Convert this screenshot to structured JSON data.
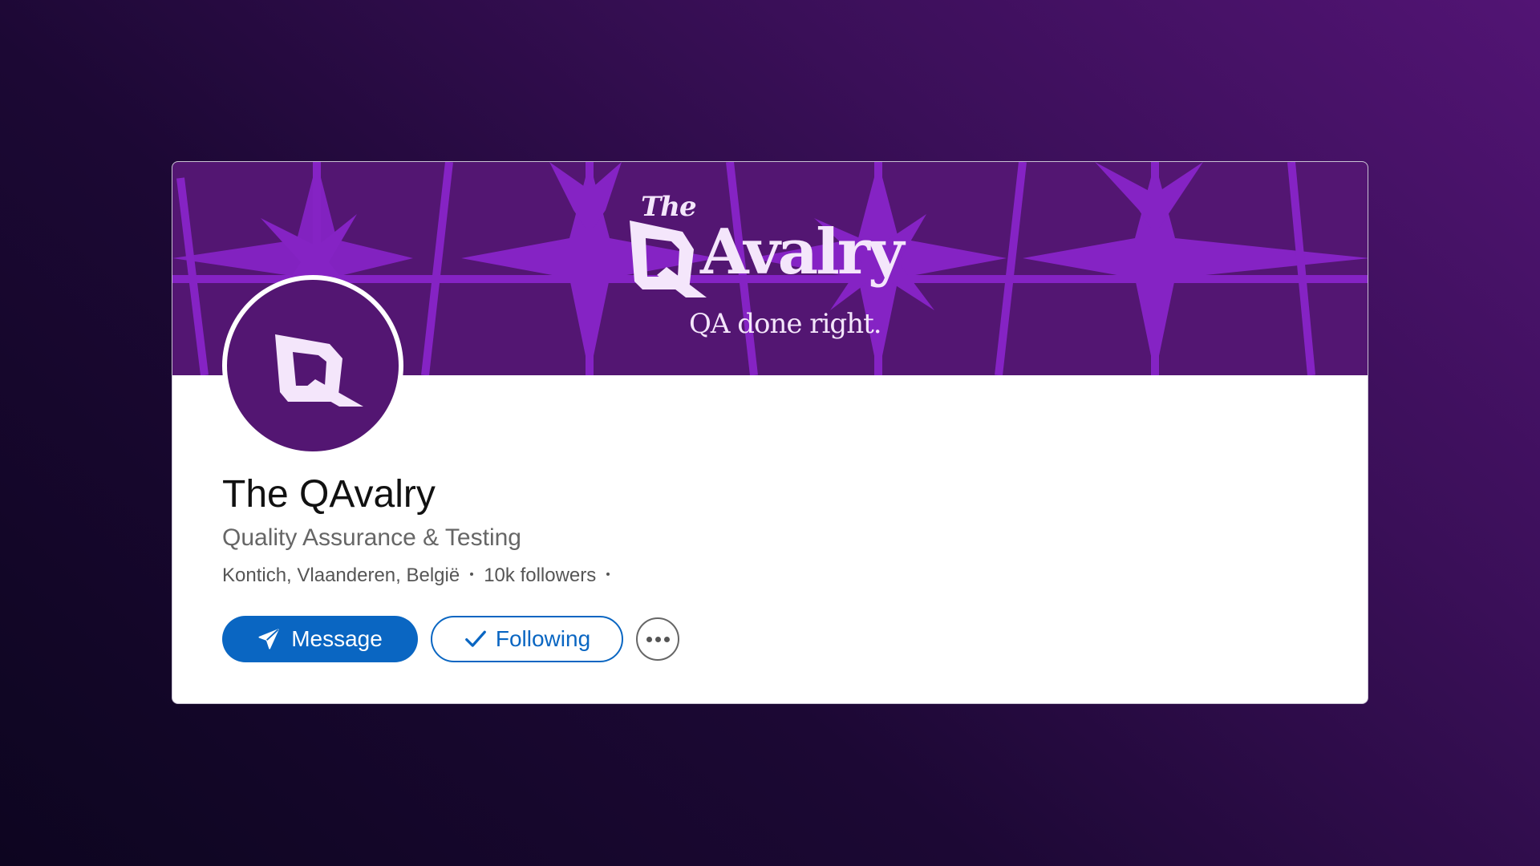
{
  "banner": {
    "brand_the": "The",
    "brand_name": "Avalry",
    "tagline": "QA done right."
  },
  "profile": {
    "name": "The QAvalry",
    "industry": "Quality Assurance & Testing",
    "location": "Kontich, Vlaanderen, België",
    "followers": "10k followers"
  },
  "actions": {
    "message_label": "Message",
    "following_label": "Following",
    "more_icon": "more-horizontal-icon"
  },
  "colors": {
    "brand_purple": "#531672",
    "pattern_purple": "#8523c4",
    "linkedin_blue": "#0a66c2",
    "brand_text": "#f4e6fb"
  }
}
